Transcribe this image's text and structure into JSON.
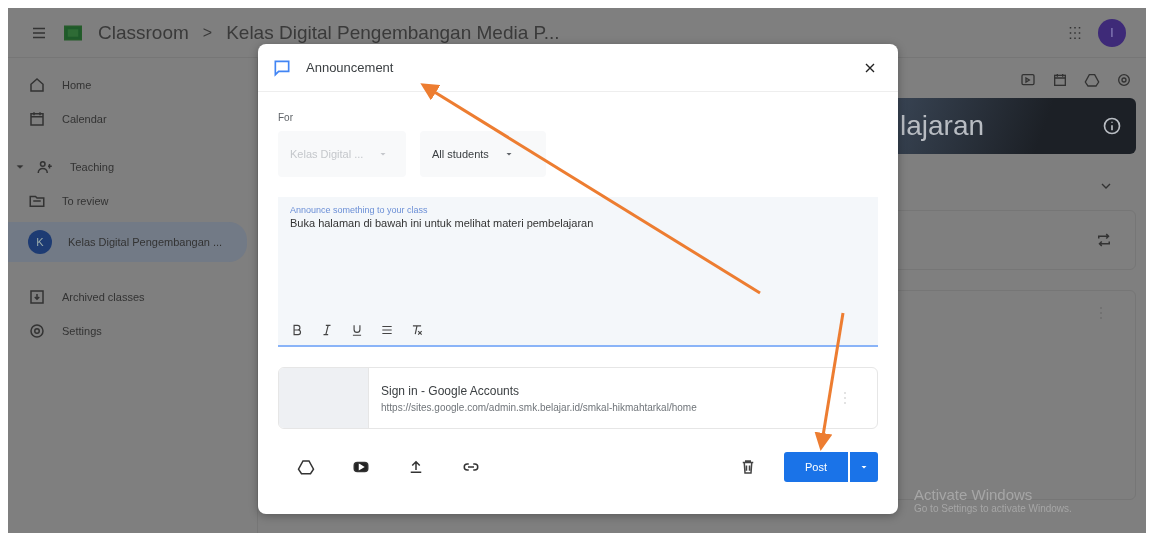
{
  "app_bar": {
    "app_name": "Classroom",
    "separator": ">",
    "breadcrumb": "Kelas Digital Pengembangan Media P...",
    "avatar_letter": "I"
  },
  "sidebar": {
    "items": [
      {
        "label": "Home",
        "kind": "icon",
        "selected": false
      },
      {
        "label": "Calendar",
        "kind": "icon",
        "selected": false
      },
      {
        "label": "Teaching",
        "kind": "group",
        "expanded": true,
        "selected": false
      },
      {
        "label": "To review",
        "kind": "icon",
        "selected": false
      },
      {
        "label": "Kelas Digital Pengembangan ...",
        "kind": "class",
        "avatar_letter": "K",
        "selected": true
      },
      {
        "label": "Archived classes",
        "kind": "icon",
        "selected": false
      },
      {
        "label": "Settings",
        "kind": "icon",
        "selected": false
      }
    ]
  },
  "class_banner": {
    "title": "lajaran"
  },
  "dialog": {
    "title": "Announcement",
    "for_label": "For",
    "selects": [
      {
        "value": "Kelas Digital ...",
        "disabled": true
      },
      {
        "value": "All students",
        "disabled": false
      }
    ],
    "editor": {
      "label": "Announce something to your class",
      "value": "Buka halaman di bawah ini untuk melihat materi pembelajaran"
    },
    "attachment": {
      "title": "Sign in - Google Accounts",
      "url": "https://sites.google.com/admin.smk.belajar.id/smkal-hikmahtarkal/home"
    },
    "post_button": "Post"
  },
  "os_notice": {
    "title": "Activate Windows",
    "subtitle": "Go to Settings to activate Windows."
  }
}
